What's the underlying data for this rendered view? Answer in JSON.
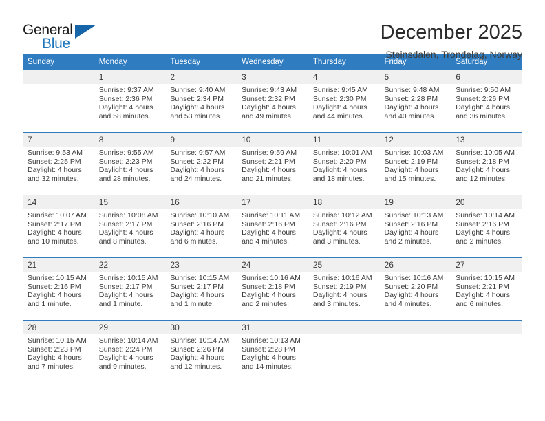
{
  "brand": {
    "name_top": "General",
    "name_bottom": "Blue",
    "accent_color": "#1565a8",
    "text_color": "#1f77bd",
    "triangle_icon": "triangle-icon"
  },
  "header": {
    "title": "December 2025",
    "subtitle": "Steinsdalen, Trondelag, Norway"
  },
  "theme": {
    "header_bar": "#2f7cc0",
    "daynum_band": "#f0f0f0",
    "row_divider": "#2f7cc0",
    "text": "#3a3a3a"
  },
  "weekday_headers": [
    "Sunday",
    "Monday",
    "Tuesday",
    "Wednesday",
    "Thursday",
    "Friday",
    "Saturday"
  ],
  "labels": {
    "sunrise_prefix": "Sunrise:",
    "sunset_prefix": "Sunset:",
    "daylight_prefix": "Daylight:"
  },
  "weeks": [
    [
      {
        "day": "",
        "blank": true,
        "lines": []
      },
      {
        "day": "1",
        "lines": [
          "Sunrise: 9:37 AM",
          "Sunset: 2:36 PM",
          "Daylight: 4 hours",
          "and 58 minutes."
        ]
      },
      {
        "day": "2",
        "lines": [
          "Sunrise: 9:40 AM",
          "Sunset: 2:34 PM",
          "Daylight: 4 hours",
          "and 53 minutes."
        ]
      },
      {
        "day": "3",
        "lines": [
          "Sunrise: 9:43 AM",
          "Sunset: 2:32 PM",
          "Daylight: 4 hours",
          "and 49 minutes."
        ]
      },
      {
        "day": "4",
        "lines": [
          "Sunrise: 9:45 AM",
          "Sunset: 2:30 PM",
          "Daylight: 4 hours",
          "and 44 minutes."
        ]
      },
      {
        "day": "5",
        "lines": [
          "Sunrise: 9:48 AM",
          "Sunset: 2:28 PM",
          "Daylight: 4 hours",
          "and 40 minutes."
        ]
      },
      {
        "day": "6",
        "lines": [
          "Sunrise: 9:50 AM",
          "Sunset: 2:26 PM",
          "Daylight: 4 hours",
          "and 36 minutes."
        ]
      }
    ],
    [
      {
        "day": "7",
        "lines": [
          "Sunrise: 9:53 AM",
          "Sunset: 2:25 PM",
          "Daylight: 4 hours",
          "and 32 minutes."
        ]
      },
      {
        "day": "8",
        "lines": [
          "Sunrise: 9:55 AM",
          "Sunset: 2:23 PM",
          "Daylight: 4 hours",
          "and 28 minutes."
        ]
      },
      {
        "day": "9",
        "lines": [
          "Sunrise: 9:57 AM",
          "Sunset: 2:22 PM",
          "Daylight: 4 hours",
          "and 24 minutes."
        ]
      },
      {
        "day": "10",
        "lines": [
          "Sunrise: 9:59 AM",
          "Sunset: 2:21 PM",
          "Daylight: 4 hours",
          "and 21 minutes."
        ]
      },
      {
        "day": "11",
        "lines": [
          "Sunrise: 10:01 AM",
          "Sunset: 2:20 PM",
          "Daylight: 4 hours",
          "and 18 minutes."
        ]
      },
      {
        "day": "12",
        "lines": [
          "Sunrise: 10:03 AM",
          "Sunset: 2:19 PM",
          "Daylight: 4 hours",
          "and 15 minutes."
        ]
      },
      {
        "day": "13",
        "lines": [
          "Sunrise: 10:05 AM",
          "Sunset: 2:18 PM",
          "Daylight: 4 hours",
          "and 12 minutes."
        ]
      }
    ],
    [
      {
        "day": "14",
        "lines": [
          "Sunrise: 10:07 AM",
          "Sunset: 2:17 PM",
          "Daylight: 4 hours",
          "and 10 minutes."
        ]
      },
      {
        "day": "15",
        "lines": [
          "Sunrise: 10:08 AM",
          "Sunset: 2:17 PM",
          "Daylight: 4 hours",
          "and 8 minutes."
        ]
      },
      {
        "day": "16",
        "lines": [
          "Sunrise: 10:10 AM",
          "Sunset: 2:16 PM",
          "Daylight: 4 hours",
          "and 6 minutes."
        ]
      },
      {
        "day": "17",
        "lines": [
          "Sunrise: 10:11 AM",
          "Sunset: 2:16 PM",
          "Daylight: 4 hours",
          "and 4 minutes."
        ]
      },
      {
        "day": "18",
        "lines": [
          "Sunrise: 10:12 AM",
          "Sunset: 2:16 PM",
          "Daylight: 4 hours",
          "and 3 minutes."
        ]
      },
      {
        "day": "19",
        "lines": [
          "Sunrise: 10:13 AM",
          "Sunset: 2:16 PM",
          "Daylight: 4 hours",
          "and 2 minutes."
        ]
      },
      {
        "day": "20",
        "lines": [
          "Sunrise: 10:14 AM",
          "Sunset: 2:16 PM",
          "Daylight: 4 hours",
          "and 2 minutes."
        ]
      }
    ],
    [
      {
        "day": "21",
        "lines": [
          "Sunrise: 10:15 AM",
          "Sunset: 2:16 PM",
          "Daylight: 4 hours",
          "and 1 minute."
        ]
      },
      {
        "day": "22",
        "lines": [
          "Sunrise: 10:15 AM",
          "Sunset: 2:17 PM",
          "Daylight: 4 hours",
          "and 1 minute."
        ]
      },
      {
        "day": "23",
        "lines": [
          "Sunrise: 10:15 AM",
          "Sunset: 2:17 PM",
          "Daylight: 4 hours",
          "and 1 minute."
        ]
      },
      {
        "day": "24",
        "lines": [
          "Sunrise: 10:16 AM",
          "Sunset: 2:18 PM",
          "Daylight: 4 hours",
          "and 2 minutes."
        ]
      },
      {
        "day": "25",
        "lines": [
          "Sunrise: 10:16 AM",
          "Sunset: 2:19 PM",
          "Daylight: 4 hours",
          "and 3 minutes."
        ]
      },
      {
        "day": "26",
        "lines": [
          "Sunrise: 10:16 AM",
          "Sunset: 2:20 PM",
          "Daylight: 4 hours",
          "and 4 minutes."
        ]
      },
      {
        "day": "27",
        "lines": [
          "Sunrise: 10:15 AM",
          "Sunset: 2:21 PM",
          "Daylight: 4 hours",
          "and 6 minutes."
        ]
      }
    ],
    [
      {
        "day": "28",
        "lines": [
          "Sunrise: 10:15 AM",
          "Sunset: 2:23 PM",
          "Daylight: 4 hours",
          "and 7 minutes."
        ]
      },
      {
        "day": "29",
        "lines": [
          "Sunrise: 10:14 AM",
          "Sunset: 2:24 PM",
          "Daylight: 4 hours",
          "and 9 minutes."
        ]
      },
      {
        "day": "30",
        "lines": [
          "Sunrise: 10:14 AM",
          "Sunset: 2:26 PM",
          "Daylight: 4 hours",
          "and 12 minutes."
        ]
      },
      {
        "day": "31",
        "lines": [
          "Sunrise: 10:13 AM",
          "Sunset: 2:28 PM",
          "Daylight: 4 hours",
          "and 14 minutes."
        ]
      },
      {
        "day": "",
        "lines": []
      },
      {
        "day": "",
        "lines": []
      },
      {
        "day": "",
        "lines": []
      }
    ]
  ]
}
